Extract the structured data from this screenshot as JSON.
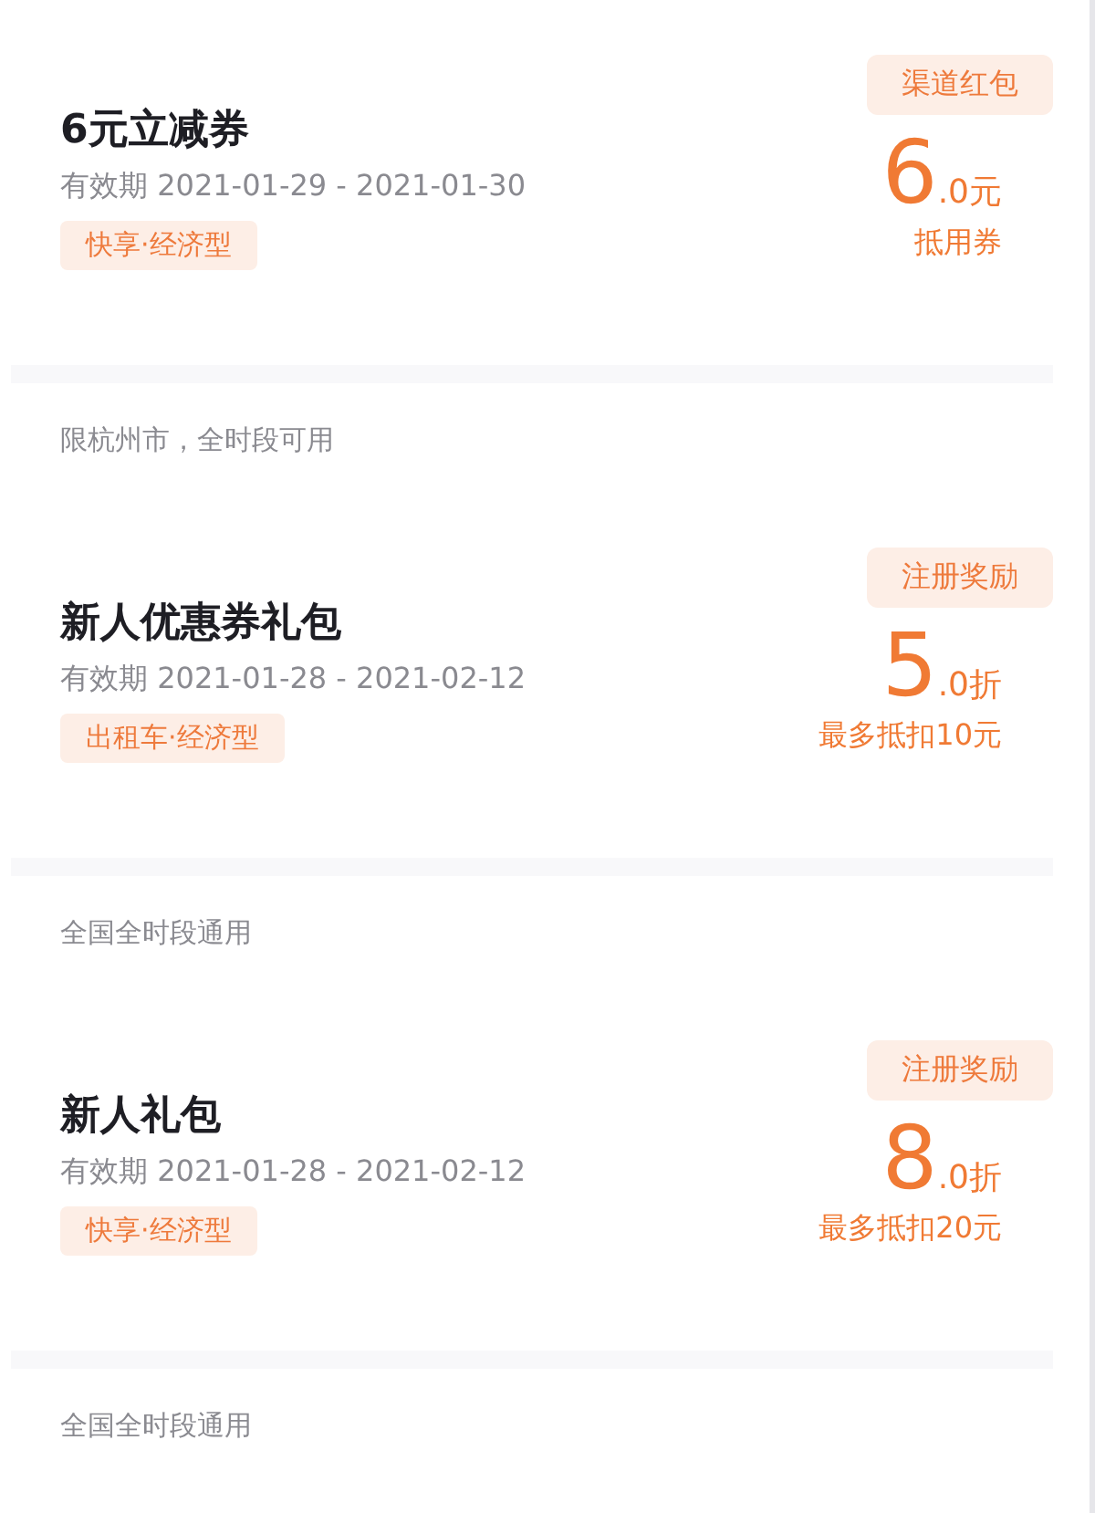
{
  "coupons": [
    {
      "title": "6元立减券",
      "validity": "有效期 2021-01-29 - 2021-01-30",
      "tag": "快享·经济型",
      "source": "渠道红包",
      "amount_main": "6",
      "amount_rest": ".0元",
      "amount_note": "抵用券",
      "scope": "限杭州市，全时段可用"
    },
    {
      "title": "新人优惠券礼包",
      "validity": "有效期 2021-01-28 - 2021-02-12",
      "tag": "出租车·经济型",
      "source": "注册奖励",
      "amount_main": "5",
      "amount_rest": ".0折",
      "amount_note": "最多抵扣10元",
      "scope": "全国全时段通用"
    },
    {
      "title": "新人礼包",
      "validity": "有效期 2021-01-28 - 2021-02-12",
      "tag": "快享·经济型",
      "source": "注册奖励",
      "amount_main": "8",
      "amount_rest": ".0折",
      "amount_note": "最多抵扣20元",
      "scope": "全国全时段通用"
    }
  ]
}
